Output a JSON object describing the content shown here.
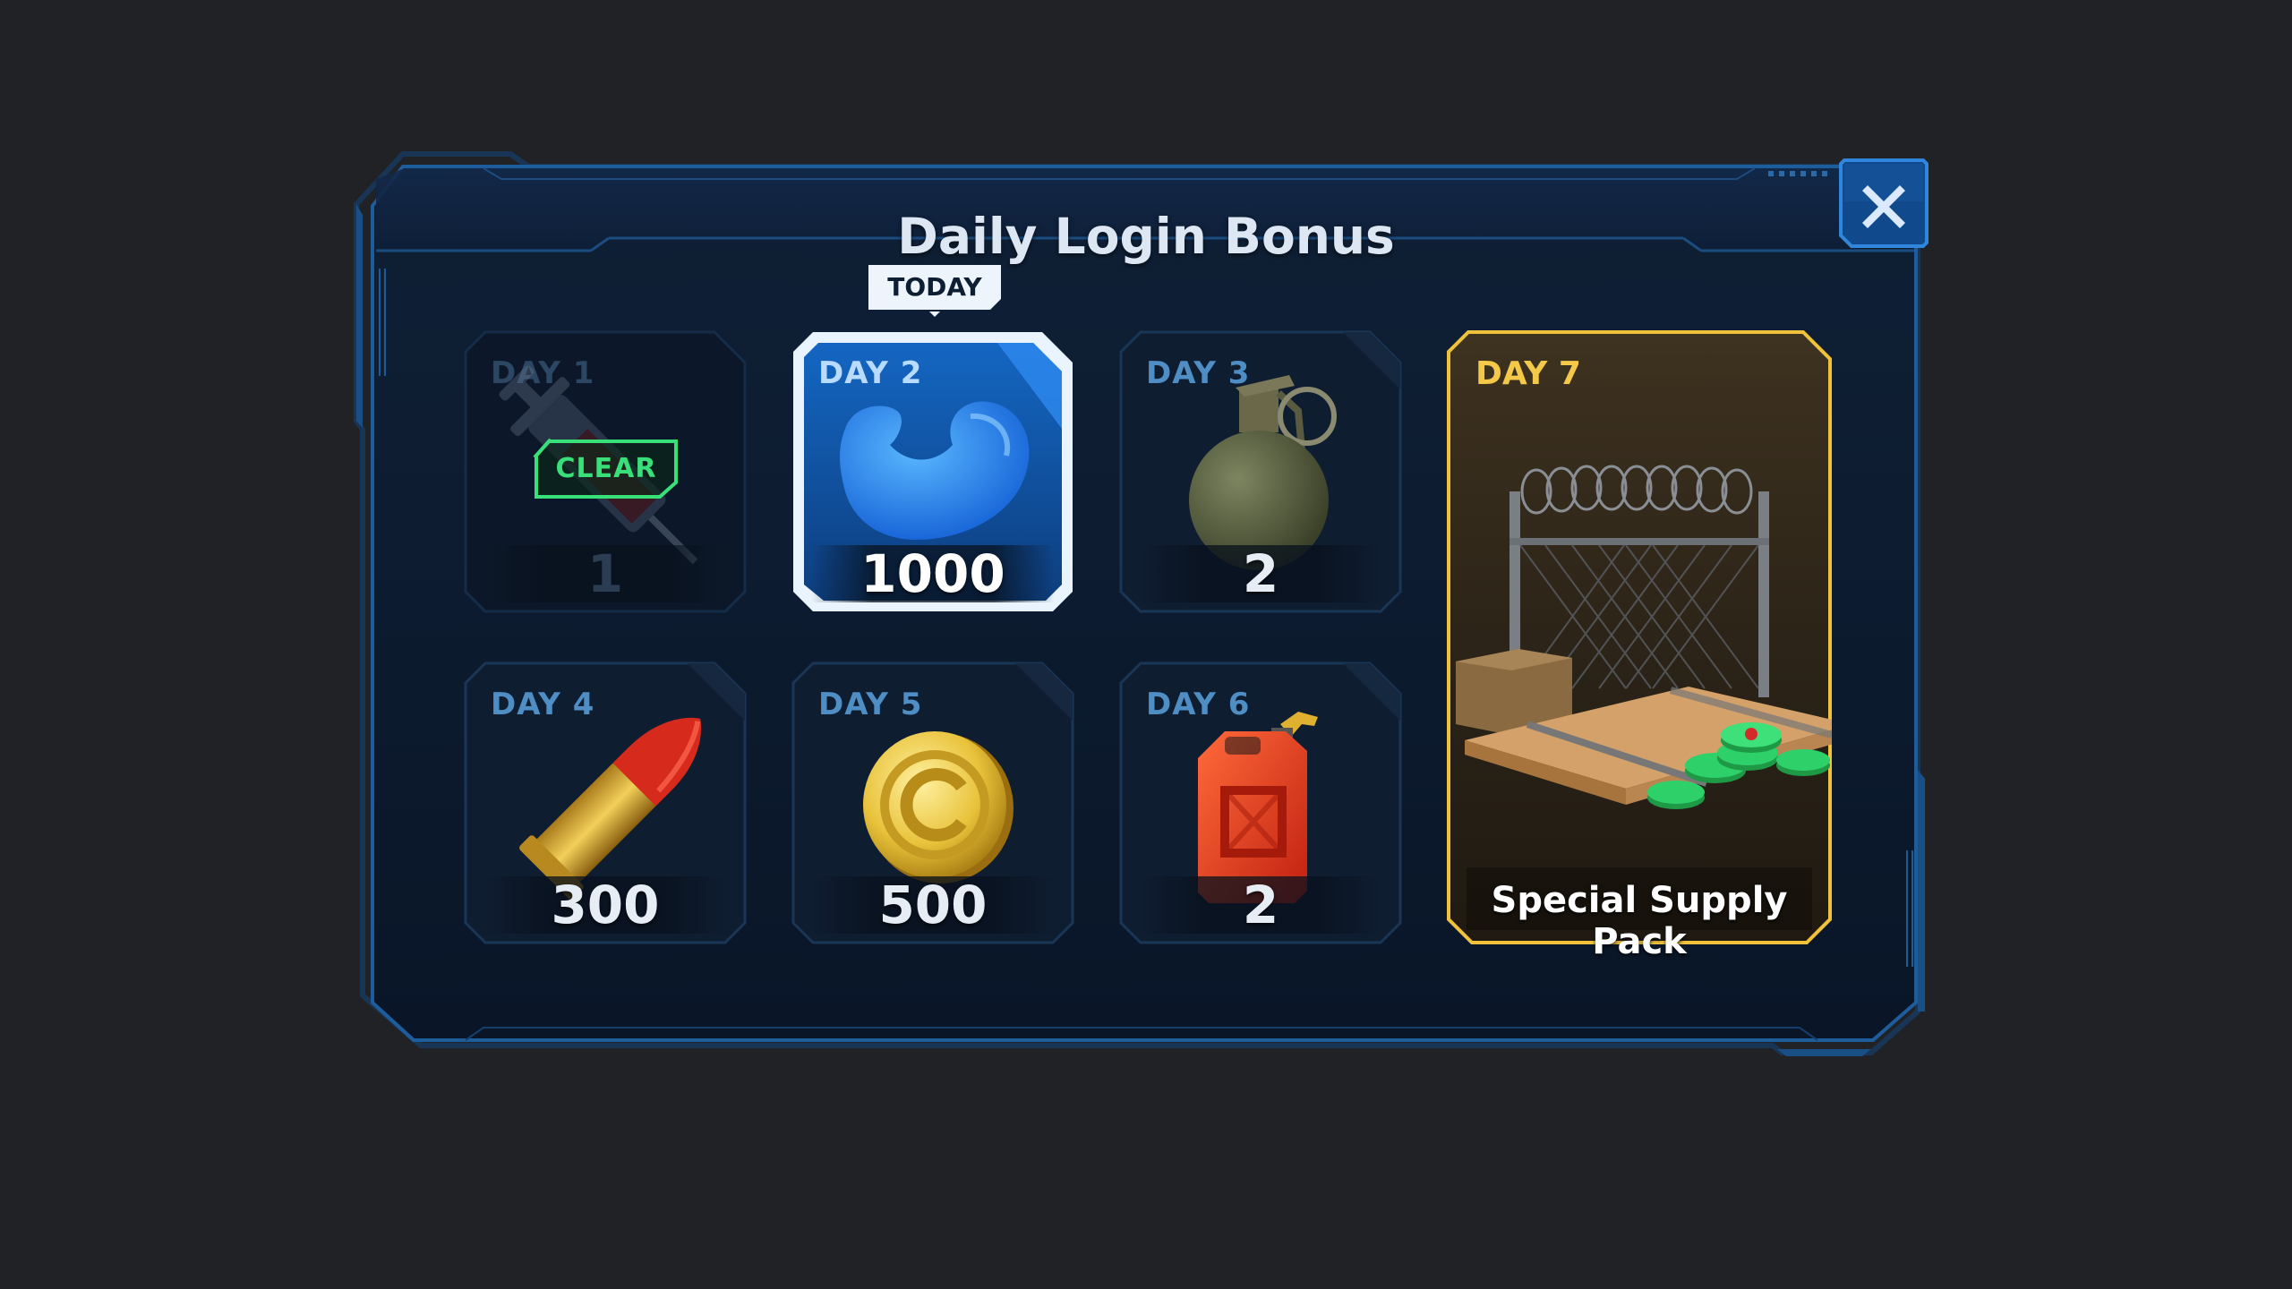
{
  "dialog": {
    "title": "Daily Login Bonus",
    "close_icon": "close-icon",
    "today_tag": "TODAY",
    "clear_stamp": "CLEAR"
  },
  "days": [
    {
      "label": "DAY 1",
      "reward": "syringe",
      "count": "1",
      "state": "claimed"
    },
    {
      "label": "DAY 2",
      "reward": "muscle-arm",
      "count": "1000",
      "state": "today"
    },
    {
      "label": "DAY 3",
      "reward": "grenade",
      "count": "2",
      "state": "locked"
    },
    {
      "label": "DAY 4",
      "reward": "bullet",
      "count": "300",
      "state": "locked"
    },
    {
      "label": "DAY 5",
      "reward": "gold-coin",
      "count": "500",
      "state": "locked"
    },
    {
      "label": "DAY 6",
      "reward": "fuel-can",
      "count": "2",
      "state": "locked"
    }
  ],
  "day7": {
    "label": "DAY 7",
    "reward": "supply-crate",
    "name": "Special Supply Pack",
    "state": "locked"
  },
  "colors": {
    "background": "#202226",
    "panel": "#0c1a2e",
    "border": "#1f5f9e",
    "highlight": "#1e7ad6",
    "gold": "#e0b43a",
    "clear_green": "#39e07a"
  }
}
